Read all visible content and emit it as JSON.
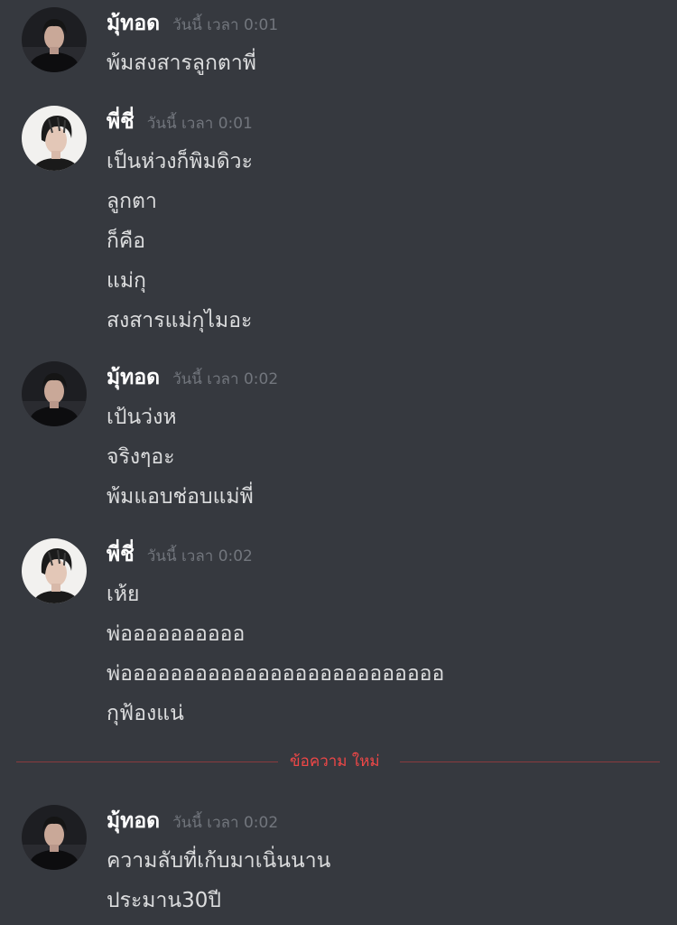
{
  "accent_colors": {
    "background": "#36393f",
    "username": "#ffffff",
    "message_text": "#dcddde",
    "timestamp": "#72767d",
    "new_messages": "#f04747"
  },
  "messages": [
    {
      "avatar": "avatar-dark-icon",
      "username": "มุ้ทอด",
      "timestamp": "วันนี้ เวลา 0:01",
      "lines": [
        "พ้มสงสารลูกตาพี่"
      ]
    },
    {
      "avatar": "avatar-light-icon",
      "username": "พี่ชี่",
      "timestamp": "วันนี้ เวลา 0:01",
      "lines": [
        "เป็นห่วงก็พิมดิวะ",
        "ลูกตา",
        "ก็คือ",
        "แม่กุ",
        "สงสารแม่กุไมอะ"
      ]
    },
    {
      "avatar": "avatar-dark-icon",
      "username": "มุ้ทอด",
      "timestamp": "วันนี้ เวลา 0:02",
      "lines": [
        "เป้นว่งห",
        "จริงๆอะ",
        "พ้มแอบช่อบแม่พี่"
      ]
    },
    {
      "avatar": "avatar-light-icon",
      "username": "พี่ชี่",
      "timestamp": "วันนี้ เวลา 0:02",
      "lines": [
        "เห้ย",
        "พ่ออออออออออ",
        "พ่ออออออออออออออออออออออออออ",
        "กุฟ้องแน่"
      ]
    },
    {
      "avatar": "avatar-dark-icon",
      "username": "มุ้ทอด",
      "timestamp": "วันนี้ เวลา 0:02",
      "lines": [
        "ความลับที่เก้บมาเนิ่นนาน",
        "ประมาน30ปี"
      ]
    }
  ],
  "divider": {
    "label": "ข้อความ ใหม่"
  }
}
